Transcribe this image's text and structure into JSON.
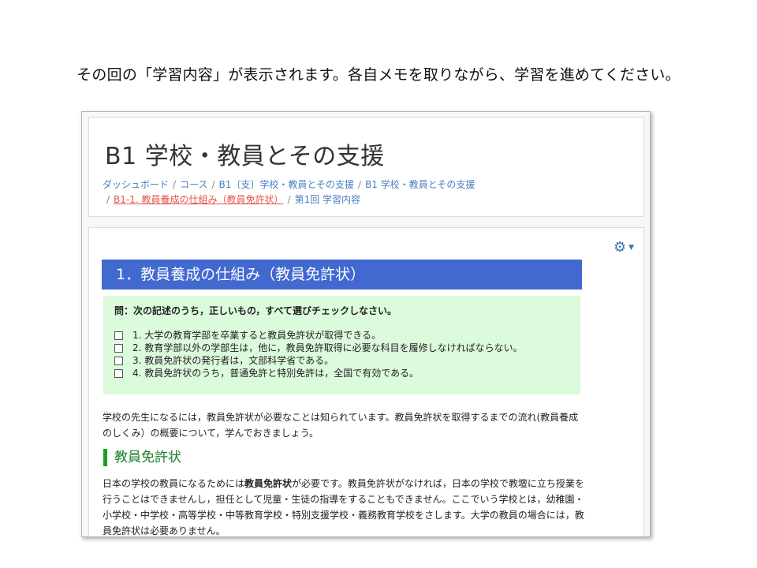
{
  "caption": "その回の「学習内容」が表示されます。各自メモを取りながら、学習を進めてください。",
  "header": {
    "title": "B1 学校・教員とその支援",
    "breadcrumb": [
      "ダッシュボード",
      "コース",
      "B1〔支〕学校・教員とその支援",
      "B1 学校・教員とその支援",
      "B1-1. 教員養成の仕組み（教員免許状）",
      "第1回 学習内容"
    ],
    "separator": "/"
  },
  "content": {
    "gear_icon": "gear-icon",
    "section_title": "1．教員養成の仕組み（教員免許状）",
    "quiz": {
      "question": "問：次の記述のうち，正しいもの，すべて選びチェックしなさい。",
      "options": [
        "1.  大学の教育学部を卒業すると教員免許状が取得できる。",
        "2.  教育学部以外の学部生は，他に，教員免許取得に必要な科目を履修しなければならない。",
        "3.  教員免許状の発行者は，文部科学省である。",
        "4.  教員免許状のうち，普通免許と特別免許は，全国で有効である。"
      ]
    },
    "intro": "学校の先生になるには，教員免許状が必要なことは知られています。教員免許状を取得するまでの流れ(教員養成のしくみ）の概要について，学んでおきましょう。",
    "subheading": "教員免許状",
    "body_pre": "日本の学校の教員になるためには",
    "body_bold": "教員免許状",
    "body_post": "が必要です。教員免許状がなければ，日本の学校で教壇に立ち授業を行うことはできませんし，担任として児童・生徒の指導をすることもできません。ここでいう学校とは，幼稚園・小学校・中学校・高等学校・中等教育学校・特別支援学校・義務教育学校をさします。大学の教員の場合には，教員免許状は必要ありません。"
  },
  "colors": {
    "section_bar": "#4169cf",
    "quiz_bg": "#dcfadc",
    "link": "#4a80c4",
    "active_link": "#e8524c",
    "subheading": "#1a7c2a"
  }
}
